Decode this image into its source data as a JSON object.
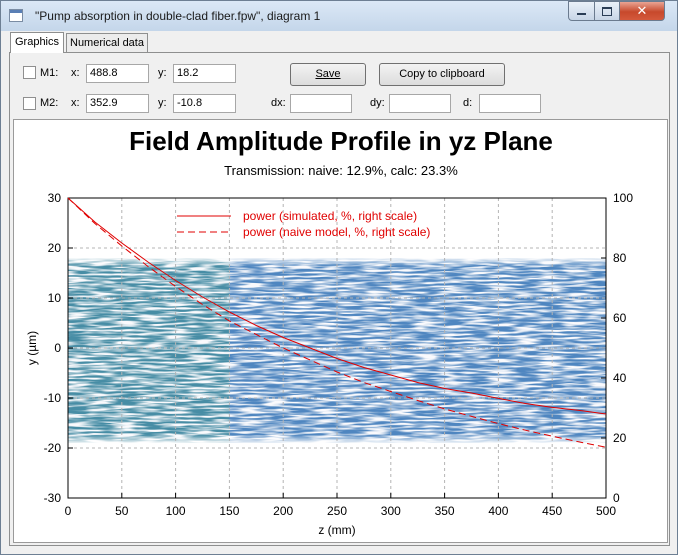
{
  "window": {
    "title": "\"Pump absorption in double-clad fiber.fpw\", diagram 1"
  },
  "tabs": [
    {
      "label": "Graphics"
    },
    {
      "label": "Numerical data"
    }
  ],
  "markers": {
    "m1": {
      "label": "M1:",
      "x_label": "x:",
      "x": "488.8",
      "y_label": "y:",
      "y": "18.2"
    },
    "m2": {
      "label": "M2:",
      "x_label": "x:",
      "x": "352.9",
      "y_label": "y:",
      "y": "-10.8"
    },
    "dx_label": "dx:",
    "dx": "",
    "dy_label": "dy:",
    "dy": "",
    "d_label": "d:",
    "d": ""
  },
  "buttons": {
    "save": "Save",
    "copy": "Copy to clipboard"
  },
  "chart_data": {
    "type": "line",
    "title": "Field Amplitude Profile in yz Plane",
    "subtitle": "Transmission: naive: 12.9%, calc: 23.3%",
    "xlabel": "z (mm)",
    "ylabel": "y (µm)",
    "xlim": [
      0,
      500
    ],
    "ylim": [
      -30,
      30
    ],
    "y2lim": [
      0,
      100
    ],
    "x_ticks": [
      "0",
      "50",
      "100",
      "150",
      "200",
      "250",
      "300",
      "350",
      "400",
      "450",
      "500"
    ],
    "y_ticks": [
      "30",
      "20",
      "10",
      "0",
      "-10",
      "-20",
      "-30"
    ],
    "y2_ticks": [
      "100",
      "80",
      "60",
      "40",
      "20",
      "0"
    ],
    "grid": true,
    "legend_position": "top-center",
    "background_field": {
      "y_range": [
        -19,
        18
      ],
      "colors": [
        "#4f86c0",
        "#3a9a74",
        "#dbe8f4"
      ]
    },
    "series": [
      {
        "name": "power (simulated, %, right scale)",
        "style": "solid",
        "color": "#e00000",
        "x": [
          0,
          25,
          50,
          75,
          100,
          125,
          150,
          175,
          200,
          225,
          250,
          275,
          300,
          325,
          350,
          375,
          400,
          425,
          450,
          475,
          500
        ],
        "y": [
          100,
          92,
          85,
          78.5,
          72.5,
          67,
          62,
          57.5,
          53.5,
          50,
          46.5,
          43.5,
          41,
          38.5,
          36.5,
          35,
          33.2,
          31.5,
          30.2,
          29.2,
          28
        ]
      },
      {
        "name": "power (naive model, %, right scale)",
        "style": "dashed",
        "color": "#e00000",
        "x": [
          0,
          25,
          50,
          75,
          100,
          125,
          150,
          175,
          200,
          225,
          250,
          275,
          300,
          325,
          350,
          375,
          400,
          425,
          450,
          475,
          500
        ],
        "y": [
          100,
          91.5,
          84,
          77,
          70.5,
          64.5,
          59,
          54.5,
          50,
          46,
          42,
          38.5,
          35.5,
          32.5,
          29.7,
          27.2,
          24.8,
          22.6,
          20.6,
          18.7,
          16.9
        ]
      }
    ]
  }
}
